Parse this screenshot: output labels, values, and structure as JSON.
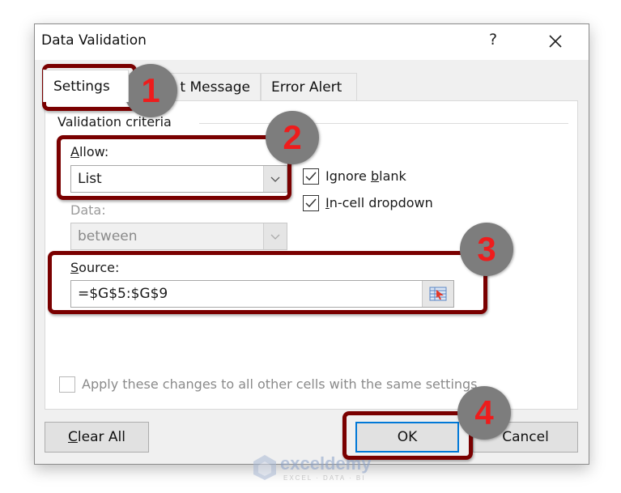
{
  "window": {
    "title": "Data Validation",
    "help_label": "?",
    "close_icon": "close-icon"
  },
  "tabs": [
    {
      "label": "Settings",
      "active": true
    },
    {
      "label": "Input Message",
      "visible_label": "t Message",
      "active": false
    },
    {
      "label": "Error Alert",
      "active": false
    }
  ],
  "settings": {
    "group_label": "Validation criteria",
    "allow": {
      "label_underline": "A",
      "label_rest": "llow:",
      "value": "List"
    },
    "data": {
      "label": "Data:",
      "value": "between",
      "disabled": true
    },
    "ignore_blank": {
      "pre": "Ignore ",
      "underline": "b",
      "post": "lank",
      "checked": true
    },
    "in_cell_dropdown": {
      "pre": "",
      "underline": "I",
      "post": "n-cell dropdown",
      "checked": true
    },
    "source": {
      "label_underline": "S",
      "label_rest": "ource:",
      "value": "=$G$5:$G$9",
      "ref_icon": "range-select-icon"
    },
    "apply_all": {
      "label": "Apply these changes to all other cells with the same settings",
      "checked": false,
      "disabled": true
    }
  },
  "buttons": {
    "clear_all": {
      "underline": "C",
      "rest": "lear All"
    },
    "ok": "OK",
    "cancel": "Cancel"
  },
  "annotations": {
    "steps": [
      "1",
      "2",
      "3",
      "4"
    ],
    "highlight_color": "#7a0000",
    "badge_color": "#7d7d7d",
    "number_color": "#ee1c1c"
  },
  "watermark": {
    "brand": "exceldemy",
    "tagline": "EXCEL · DATA · BI"
  }
}
